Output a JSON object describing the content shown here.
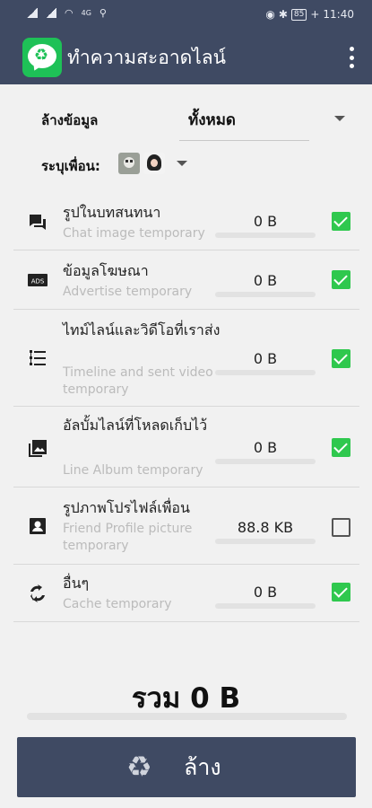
{
  "status_bar": {
    "network_type": "4G",
    "time": "11:40",
    "battery": "85"
  },
  "app_bar": {
    "title": "ทำความสะอาดไลน์"
  },
  "filters": {
    "clear_data_label": "ล้างข้อมูล",
    "clear_data_value": "ทั้งหมด",
    "friend_label": "ระบุเพื่อน:"
  },
  "categories": [
    {
      "title": "รูปในบทสนทนา",
      "subtitle": "Chat image temporary",
      "size": "0 B",
      "checked": true,
      "icon": "chat-icon"
    },
    {
      "title": "ข้อมูลโฆษณา",
      "subtitle": "Advertise temporary",
      "size": "0 B",
      "checked": true,
      "icon": "ads-icon"
    },
    {
      "title": "ไทม์ไลน์และวิดีโอที่เราส่ง",
      "subtitle": "Timeline and sent video temporary",
      "size": "0 B",
      "checked": true,
      "icon": "timeline-icon"
    },
    {
      "title": "อัลบั้มไลน์ที่โหลดเก็บไว้",
      "subtitle": "Line Album temporary",
      "size": "0 B",
      "checked": true,
      "icon": "album-icon"
    },
    {
      "title": "รูปภาพโปรไฟล์เพื่อน",
      "subtitle": "Friend Profile picture temporary",
      "size": "88.8 KB",
      "checked": false,
      "icon": "profile-icon"
    },
    {
      "title": "อื่นๆ",
      "subtitle": "Cache temporary",
      "size": "0 B",
      "checked": true,
      "icon": "cache-icon"
    }
  ],
  "total": {
    "text": "รวม 0 B"
  },
  "clean_button": {
    "label": "ล้าง",
    "icon": "recycle-icon"
  },
  "colors": {
    "header": "#3f4a63",
    "check_green": "#2fc84e",
    "logo_green": "#1ec157"
  }
}
